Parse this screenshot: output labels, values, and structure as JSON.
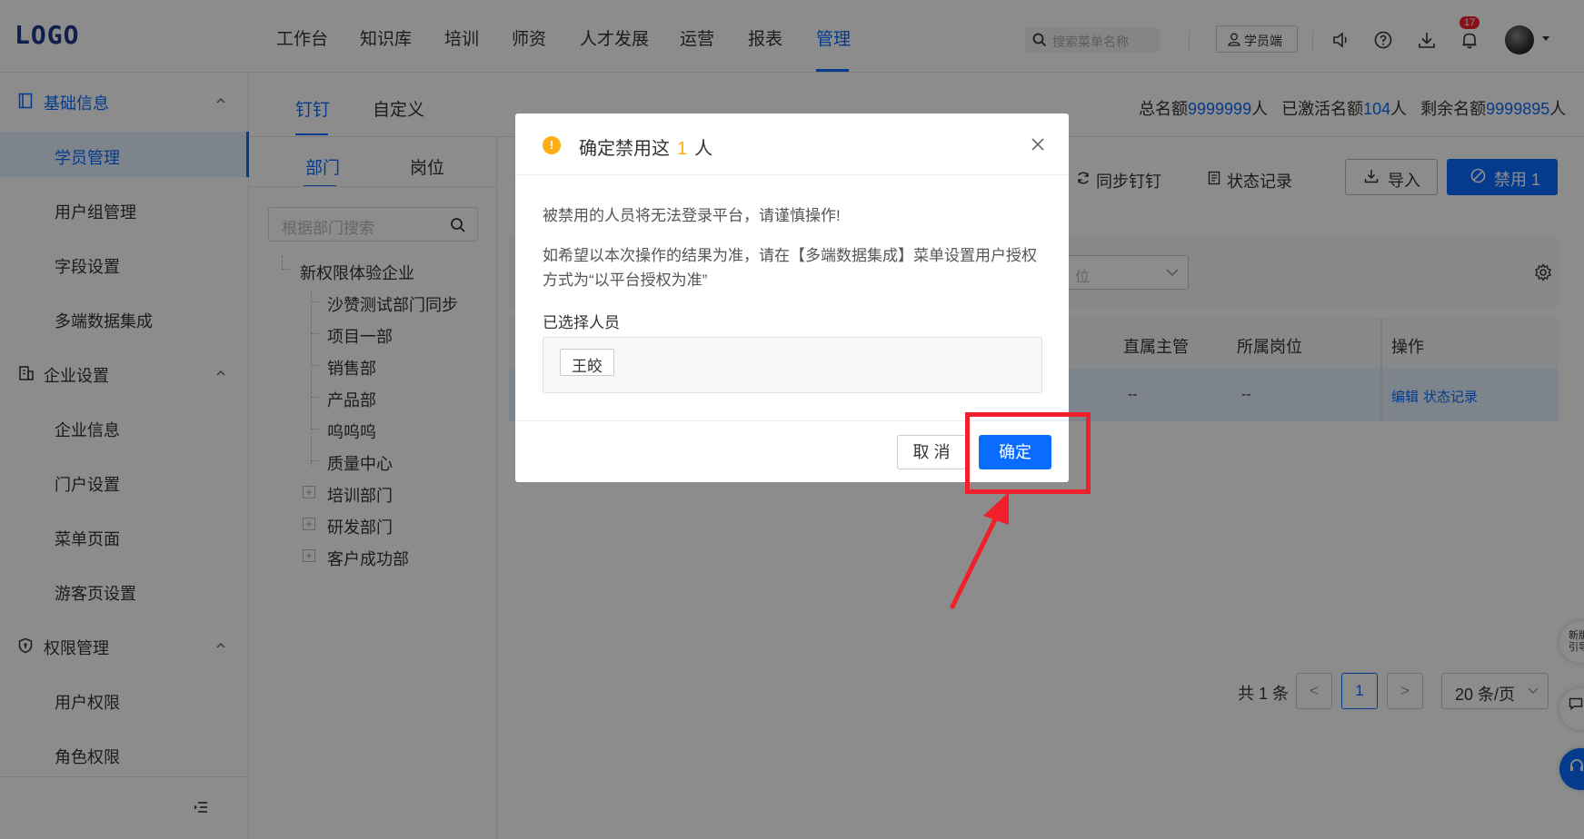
{
  "header": {
    "logo": "LOGO",
    "nav": [
      "工作台",
      "知识库",
      "培训",
      "师资",
      "人才发展",
      "运营",
      "报表",
      "管理"
    ],
    "active_nav": "管理",
    "search_placeholder": "搜索菜单名称",
    "student_btn": "学员端",
    "notification_count": "17",
    "icons": [
      "speaker-icon",
      "help-icon",
      "download-icon",
      "bell-icon"
    ]
  },
  "sidebar": {
    "groups": [
      {
        "label": "基础信息",
        "icon": "book-icon",
        "items": [
          "学员管理",
          "用户组管理",
          "字段设置",
          "多端数据集成"
        ]
      },
      {
        "label": "企业设置",
        "icon": "building-icon",
        "items": [
          "企业信息",
          "门户设置",
          "菜单页面",
          "游客页设置"
        ]
      },
      {
        "label": "权限管理",
        "icon": "shield-icon",
        "items": [
          "用户权限",
          "角色权限"
        ]
      }
    ],
    "active_item": "学员管理"
  },
  "content": {
    "tabs": [
      "钉钉",
      "自定义"
    ],
    "quota": {
      "total_label": "总名额",
      "total": "9999999",
      "unit": "人",
      "activated_label": "已激活名额",
      "activated": "104",
      "remaining_label": "剩余名额",
      "remaining": "9999895"
    },
    "subtabs": [
      "部门",
      "岗位"
    ],
    "dept_search_placeholder": "根据部门搜索",
    "tree": {
      "root": "新权限体验企业",
      "children": [
        "沙赞测试部门同步",
        "项目一部",
        "销售部",
        "产品部",
        "呜呜呜",
        "质量中心"
      ],
      "collapsed": [
        "培训部门",
        "研发部门",
        "客户成功部"
      ]
    },
    "toolbar": {
      "sync": "同步钉钉",
      "status_log": "状态记录",
      "import": "导入",
      "disable": "禁用 1"
    },
    "filter_select_partial": "位",
    "table": {
      "headers": [
        "直属主管",
        "所属岗位",
        "操作"
      ],
      "row": {
        "manager": "--",
        "position": "--",
        "edit": "编辑",
        "status_log": "状态记录"
      }
    },
    "pagination": {
      "total": "共 1 条",
      "prev": "<",
      "page": "1",
      "next": ">",
      "page_size": "20 条/页"
    },
    "float_tip": "新版\n引导"
  },
  "modal": {
    "title_prefix": "确定禁用这",
    "count": "1",
    "title_suffix": "人",
    "warning": "被禁用的人员将无法登录平台，请谨慎操作!",
    "note": "如希望以本次操作的结果为准，请在【多端数据集成】菜单设置用户授权方式为“以平台授权为准”",
    "selected_label": "已选择人员",
    "selected": [
      "王皎"
    ],
    "cancel": "取 消",
    "ok": "确定"
  },
  "colors": {
    "primary": "#0a6cff",
    "warning": "#faad14",
    "annotation": "#f0202a"
  }
}
